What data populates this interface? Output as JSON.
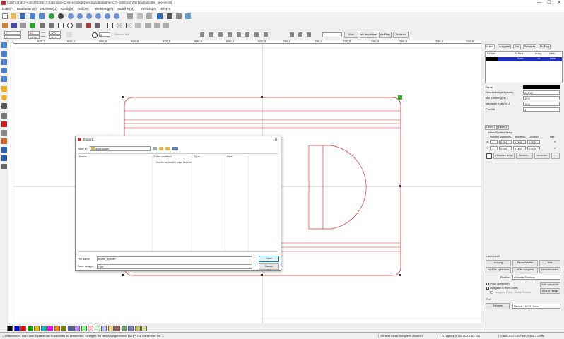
{
  "window": {
    "title": "K2Mhcs(MUF)-48-20230617-Estoniarte-C:\\Users\\dkal\\Desktop\\datakraften\\17 - Mittbord Werkmulla\\bottle_opener.ibl]",
    "minimize": "—",
    "maximize": "☐",
    "close": "✕"
  },
  "menu": [
    {
      "label": "Datei(F)"
    },
    {
      "label": "Bearbeiten(E)"
    },
    {
      "label": "Zeichnen(D)"
    },
    {
      "label": "Konfig(S)"
    },
    {
      "label": "Griff(W)"
    },
    {
      "label": "Werkzeug(T)"
    },
    {
      "label": "Modell-N(M)"
    },
    {
      "label": "Ansicht(V)"
    },
    {
      "label": "Hilfe(H)"
    }
  ],
  "toolbar3": {
    "x_value": "0",
    "y_value": "0",
    "w_value": "90",
    "h_value": "57.36",
    "unit_mm": "mm",
    "pct1": "100",
    "pct2": "100",
    "angle": "0",
    "process_no_label": "Prozess Nr:",
    "process_no": "0",
    "auto_btn": "Auto",
    "import_btn": "als importieren",
    "for_btn": "für Pfan",
    "zeichnen_btn": "Zeichnen"
  },
  "ruler_h": [
    "820,0",
    "840,0",
    "850,0",
    "860,0",
    "870,0",
    "880,0",
    "890,0",
    "800,0",
    "790,0",
    "780,0",
    "770,0",
    "760,0",
    "750,0",
    "740,0",
    "730,0"
  ],
  "right_panel": {
    "tabs": [
      "Arbeit",
      "Ausgabe",
      "Doc",
      "Benutzer",
      "Pr. Flug"
    ],
    "table_headers": [
      "Schicht",
      "Modus",
      "Ausg.",
      "Vers."
    ],
    "table_row": {
      "schicht": "",
      "modus": "Scan",
      "ausg": "Ja",
      "vers": "Nein"
    },
    "props": [
      {
        "label": "Farbe",
        "value": ""
      },
      {
        "label": "Geschwindigkeit(mm/s)",
        "value": "400.00"
      },
      {
        "label": "Min. Leistung(%)-1",
        "value": "15.0"
      },
      {
        "label": "Maximale Kraft(%)-1",
        "value": "15.0"
      },
      {
        "label": "Priorität",
        "value": "1"
      }
    ],
    "laser_tabs": [
      "Laser 1",
      "Laser 2"
    ],
    "array_title": "Zeilen/Spalten Setup",
    "array_headers": [
      "summe",
      "Abstand1",
      "Abstand2",
      "Location",
      "Bild"
    ],
    "array_rows": [
      {
        "axis": "X:",
        "sum": "1",
        "a1": "0.000",
        "a2": "0.000",
        "loc": "0.000",
        "bild": "V"
      },
      {
        "axis": "Y:",
        "sum": "1",
        "a1": "0.000",
        "a2": "0.000",
        "loc": "0.000",
        "bild": "V"
      }
    ],
    "virtual_btn": "Virtuelles Array",
    "bestrin_btn": "Bestrin...",
    "versetzen_btn": "versetzer",
    "more_btn": "...",
    "laser_work_title": "Laserarbeit",
    "anfang_btn": "Anfang",
    "pause_btn": "Pause/Weiter",
    "halt_btn": "Halt",
    "uffile_btn": "In UFile speichern",
    "uffile_out_btn": "UFile Ausgabe",
    "herunterladen_btn": "Herunterladen",
    "position_label": "Position:",
    "position_value": "Aktuelle Position",
    "pfad_opt": "Pfad optimieren",
    "ausgabe_sel": "Ausgabe w.Rhm Grafik",
    "ausgabe_filled": "Ausgabe Füllen Grafik Position",
    "kalib_btn": "kalb schneidst",
    "go_btn": "Go zur Hauge",
    "port_label": "Port",
    "rahmen_btn": "Rahmen",
    "device_value": "Device - 6-GB-Auto"
  },
  "dialog": {
    "title": "Export...",
    "save_in_label": "Save in:",
    "save_in_value": "downloads",
    "col_name": "Name",
    "col_modified": "Date modified",
    "col_type": "Type",
    "col_size": "Size",
    "empty_text": "No items match your search.",
    "file_name_label": "File name:",
    "file_name_value": "bottle_opener",
    "save_type_label": "Save as type:",
    "save_type_value": "*.plt",
    "save_btn": "Save",
    "cancel_btn": "Cancel"
  },
  "status": {
    "hint": "---Willkommen, das Laser-System das Ausschnitts zu verwenden, schlagen Sie den Anzeigebereich 1024 * 768 oder höher vor ---",
    "mode": "General mode,Komplette Anzahl:0",
    "objects": "B Objects(X:790.000,Y:57.736",
    "coords": "X:665,X:675.507mm,Y:456.172mm"
  },
  "palette": [
    "#000000",
    "#0000ff",
    "#ff0000",
    "#00aa00",
    "#e0c000",
    "#00c0c0",
    "#ff00ff",
    "#ff8000",
    "#808000",
    "#4060a0",
    "#c080ff",
    "#80ff80",
    "#ffc0c0",
    "#c0ffc0",
    "#c0c0ff",
    "#ffd080",
    "#a06060",
    "#60a060",
    "#8080c0",
    "#c0c060",
    "#e0e0a0"
  ]
}
